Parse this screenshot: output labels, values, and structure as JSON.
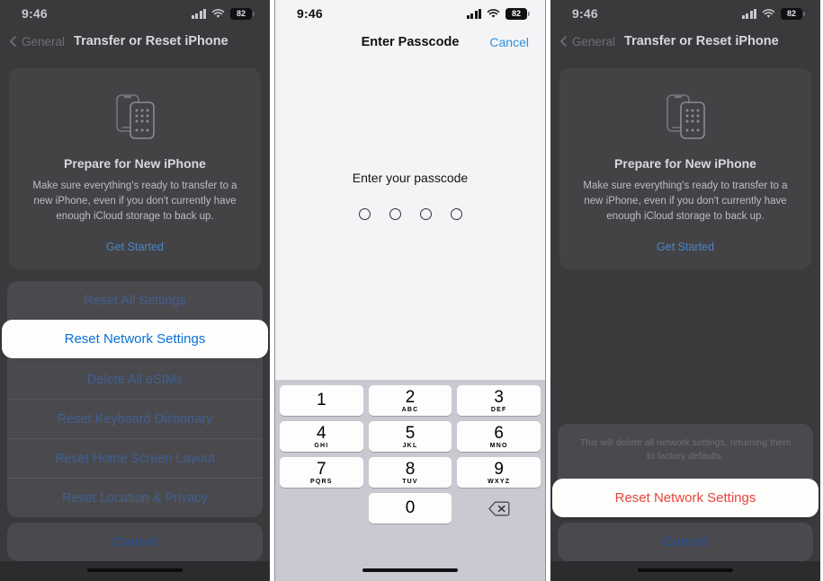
{
  "panels": [
    {
      "id": "panel-reset-options",
      "status": {
        "time": "9:46",
        "battery": "82",
        "cellular_icon": "cellular-bars-icon",
        "wifi_icon": "wifi-icon",
        "battery_icon": "battery-icon"
      },
      "nav": {
        "back_label": "General",
        "title": "Transfer or Reset iPhone",
        "back_icon": "chevron-left-icon"
      },
      "card": {
        "icon": "two-iphones-icon",
        "title": "Prepare for New iPhone",
        "body": "Make sure everything's ready to transfer to a new iPhone, even if you don't currently have enough iCloud storage to back up.",
        "link": "Get Started"
      },
      "sheet": {
        "items": [
          "Reset All Settings",
          "Reset Network Settings",
          "Delete All eSIMs",
          "Reset Keyboard Dictionary",
          "Reset Home Screen Layout",
          "Reset Location & Privacy"
        ],
        "selected_index": 1,
        "selected_label": "Reset Network Settings",
        "ghost_label": "Reset",
        "cancel": "Cancel"
      }
    },
    {
      "id": "panel-enter-passcode",
      "status": {
        "time": "9:46",
        "battery": "82",
        "cellular_icon": "cellular-bars-icon",
        "wifi_icon": "wifi-icon",
        "battery_icon": "battery-icon"
      },
      "nav": {
        "title": "Enter Passcode",
        "cancel": "Cancel"
      },
      "prompt": "Enter your passcode",
      "dots": 4,
      "filled_dots": 0,
      "keypad": {
        "keys": [
          {
            "num": "1",
            "sub": ""
          },
          {
            "num": "2",
            "sub": "ABC"
          },
          {
            "num": "3",
            "sub": "DEF"
          },
          {
            "num": "4",
            "sub": "GHI"
          },
          {
            "num": "5",
            "sub": "JKL"
          },
          {
            "num": "6",
            "sub": "MNO"
          },
          {
            "num": "7",
            "sub": "PQRS"
          },
          {
            "num": "8",
            "sub": "TUV"
          },
          {
            "num": "9",
            "sub": "WXYZ"
          },
          {
            "num": "0",
            "sub": ""
          }
        ],
        "delete_icon": "delete-backward-icon"
      }
    },
    {
      "id": "panel-confirm-reset",
      "status": {
        "time": "9:46",
        "battery": "82",
        "cellular_icon": "cellular-bars-icon",
        "wifi_icon": "wifi-icon",
        "battery_icon": "battery-icon"
      },
      "nav": {
        "back_label": "General",
        "title": "Transfer or Reset iPhone",
        "back_icon": "chevron-left-icon"
      },
      "card": {
        "icon": "two-iphones-icon",
        "title": "Prepare for New iPhone",
        "body": "Make sure everything's ready to transfer to a new iPhone, even if you don't currently have enough iCloud storage to back up.",
        "link": "Get Started"
      },
      "alert": {
        "message": "This will delete all network settings, returning them to factory defaults.",
        "destructive_label": "Reset Network Settings",
        "ghost_label": "Reset",
        "cancel": "Cancel"
      }
    }
  ],
  "colors": {
    "blue_link": "#0a70d8",
    "destructive_red": "#e8453c",
    "dark_bg": "#3a3a3c",
    "card_bg": "#434346",
    "sheet_bg": "#4a4a4e",
    "keypad_bg": "#c9c9d2",
    "passcode_bg": "#f4f4f7"
  }
}
